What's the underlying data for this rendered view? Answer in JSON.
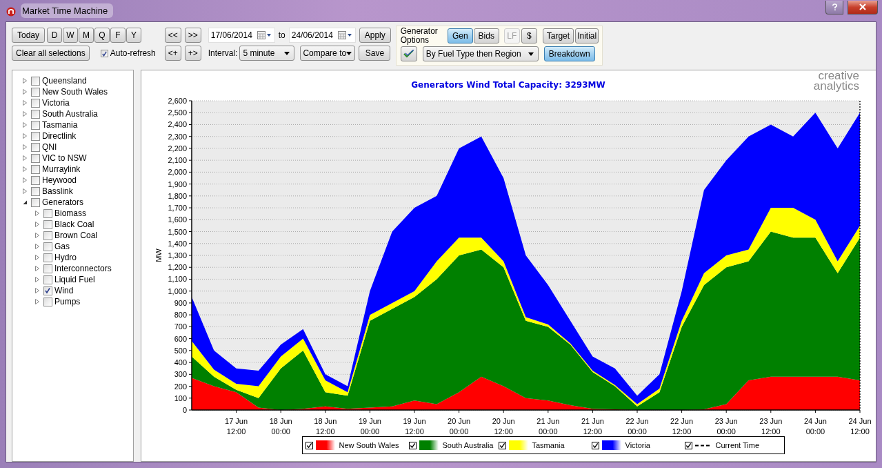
{
  "window": {
    "title": "Market Time Machine"
  },
  "toolbar": {
    "period_buttons": [
      "Today",
      "D",
      "W",
      "M",
      "Q",
      "F",
      "Y"
    ],
    "clear_button": "Clear all selections",
    "auto_refresh": {
      "label": "Auto-refresh",
      "checked": true
    },
    "nav_buttons": [
      "<<",
      ">>",
      "<+",
      "+>"
    ],
    "date_from": "17/06/2014",
    "date_separator": "to",
    "date_to": "24/06/2014",
    "apply_button": "Apply",
    "save_button": "Save",
    "interval": {
      "label": "Interval:",
      "value": "5 minute"
    },
    "compare_button": "Compare to"
  },
  "generator_options": {
    "label": "Generator Options",
    "modes": [
      {
        "label": "Gen",
        "selected": true
      },
      {
        "label": "Bids",
        "selected": false
      }
    ],
    "extras": [
      {
        "label": "LF",
        "disabled": true
      },
      {
        "label": "$",
        "disabled": false
      }
    ],
    "target_button": "Target",
    "initial_button": "Initial",
    "grouping": "By Fuel Type then Region",
    "breakdown": {
      "label": "Breakdown",
      "on": true
    }
  },
  "tree": [
    {
      "label": "Queensland",
      "checked": false,
      "expanded": false
    },
    {
      "label": "New South Wales",
      "checked": false,
      "expanded": false
    },
    {
      "label": "Victoria",
      "checked": false,
      "expanded": false
    },
    {
      "label": "South Australia",
      "checked": false,
      "expanded": false
    },
    {
      "label": "Tasmania",
      "checked": false,
      "expanded": false
    },
    {
      "label": "Directlink",
      "checked": false,
      "expanded": false
    },
    {
      "label": "QNI",
      "checked": false,
      "expanded": false
    },
    {
      "label": "VIC to NSW",
      "checked": false,
      "expanded": false
    },
    {
      "label": "Murraylink",
      "checked": false,
      "expanded": false
    },
    {
      "label": "Heywood",
      "checked": false,
      "expanded": false
    },
    {
      "label": "Basslink",
      "checked": false,
      "expanded": false
    },
    {
      "label": "Generators",
      "checked": false,
      "expanded": true,
      "children": [
        {
          "label": "Biomass",
          "checked": false,
          "expanded": false
        },
        {
          "label": "Black Coal",
          "checked": false,
          "expanded": false
        },
        {
          "label": "Brown Coal",
          "checked": false,
          "expanded": false
        },
        {
          "label": "Gas",
          "checked": false,
          "expanded": false
        },
        {
          "label": "Hydro",
          "checked": false,
          "expanded": false
        },
        {
          "label": "Interconnectors",
          "checked": false,
          "expanded": false
        },
        {
          "label": "Liquid Fuel",
          "checked": false,
          "expanded": false
        },
        {
          "label": "Wind",
          "checked": true,
          "expanded": false
        },
        {
          "label": "Pumps",
          "checked": false,
          "expanded": false
        }
      ]
    }
  ],
  "chart": {
    "logo": [
      "creative",
      "analytics"
    ],
    "chart_data": {
      "type": "area",
      "stacked": true,
      "title": "Generators Wind Total Capacity: 3293MW",
      "ylabel": "MW",
      "grid": true,
      "categories": [
        null,
        null,
        "17 Jun 12:00",
        null,
        "18 Jun 00:00",
        null,
        "18 Jun 12:00",
        null,
        "19 Jun 00:00",
        null,
        "19 Jun 12:00",
        null,
        "20 Jun 00:00",
        null,
        "20 Jun 12:00",
        null,
        "21 Jun 00:00",
        null,
        "21 Jun 12:00",
        null,
        "22 Jun 00:00",
        null,
        "22 Jun 12:00",
        null,
        "23 Jun 00:00",
        null,
        "23 Jun 12:00",
        null,
        "24 Jun 00:00",
        null,
        "24 Jun 12:00"
      ],
      "series": [
        {
          "name": "New South Wales",
          "color": "#ff0000",
          "values": [
            270,
            200,
            150,
            20,
            0,
            10,
            30,
            10,
            20,
            30,
            80,
            50,
            150,
            280,
            200,
            100,
            80,
            40,
            10,
            5,
            0,
            0,
            0,
            5,
            50,
            250,
            280,
            280,
            280,
            280,
            250
          ]
        },
        {
          "name": "South Australia",
          "color": "#008000",
          "values": [
            180,
            80,
            20,
            80,
            350,
            490,
            120,
            110,
            730,
            820,
            870,
            1050,
            1150,
            1070,
            1000,
            650,
            620,
            510,
            310,
            195,
            30,
            150,
            700,
            1045,
            1150,
            1000,
            1220,
            1170,
            1170,
            870,
            1200
          ]
        },
        {
          "name": "Tasmania",
          "color": "#ffff00",
          "values": [
            130,
            60,
            50,
            100,
            100,
            100,
            100,
            30,
            50,
            50,
            50,
            150,
            150,
            100,
            50,
            30,
            20,
            10,
            10,
            10,
            20,
            30,
            50,
            100,
            100,
            100,
            200,
            250,
            150,
            100,
            100
          ]
        },
        {
          "name": "Victoria",
          "color": "#0000ff",
          "values": [
            370,
            160,
            130,
            130,
            100,
            80,
            50,
            50,
            200,
            600,
            700,
            550,
            750,
            850,
            700,
            520,
            330,
            190,
            120,
            140,
            70,
            120,
            250,
            700,
            800,
            950,
            700,
            600,
            900,
            950,
            950
          ]
        }
      ],
      "ylim": [
        0,
        2600
      ],
      "yticks": [
        0,
        100,
        200,
        300,
        400,
        500,
        600,
        700,
        800,
        900,
        {
          "value": 1000,
          "label": "1,000"
        },
        {
          "value": 1100,
          "label": "1,100"
        },
        {
          "value": 1200,
          "label": "1,200"
        },
        {
          "value": 1300,
          "label": "1,300"
        },
        {
          "value": 1400,
          "label": "1,400"
        },
        {
          "value": 1500,
          "label": "1,500"
        },
        {
          "value": 1600,
          "label": "1,600"
        },
        {
          "value": 1700,
          "label": "1,700"
        },
        {
          "value": 1800,
          "label": "1,800"
        },
        {
          "value": 1900,
          "label": "1,900"
        },
        {
          "value": 2000,
          "label": "2,000"
        },
        {
          "value": 2100,
          "label": "2,100"
        },
        {
          "value": 2200,
          "label": "2,200"
        },
        {
          "value": 2300,
          "label": "2,300"
        },
        {
          "value": 2400,
          "label": "2,400"
        },
        {
          "value": 2500,
          "label": "2,500"
        },
        {
          "value": 2600,
          "label": "2,600"
        }
      ]
    },
    "legend": [
      {
        "checked": true,
        "kind": "series"
      },
      {
        "checked": true,
        "kind": "series"
      },
      {
        "checked": true,
        "kind": "series"
      },
      {
        "checked": true,
        "kind": "series"
      },
      {
        "label": "Current Time",
        "checked": true,
        "kind": "line"
      }
    ]
  }
}
